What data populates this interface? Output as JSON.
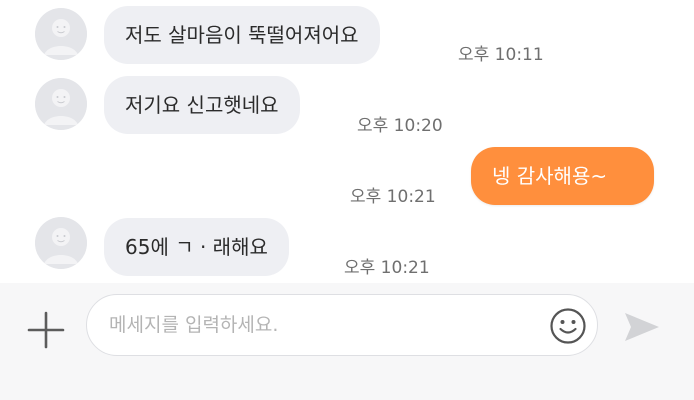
{
  "messages": [
    {
      "sender": "other",
      "text": "저도 살마음이 뚝떨어져어요",
      "time": "오후 10:11"
    },
    {
      "sender": "other",
      "text": "저기요 신고햇네요",
      "time": "오후 10:20"
    },
    {
      "sender": "me",
      "text": "넹 감사해용~",
      "time": "오후 10:21"
    },
    {
      "sender": "other",
      "text": "65에 ㄱ · 래해요",
      "time": "오후 10:21"
    }
  ],
  "composer": {
    "placeholder": "메세지를 입력하세요.",
    "value": ""
  },
  "icons": {
    "add": "plus-icon",
    "emoji": "smiley-icon",
    "send": "send-arrow-icon",
    "avatar": "default-profile-avatar"
  },
  "colors": {
    "my_bubble": "#ff8f3d",
    "their_bubble": "#eeeff3",
    "time_text": "#6f6f6f",
    "composer_bg": "#f7f7f8"
  }
}
